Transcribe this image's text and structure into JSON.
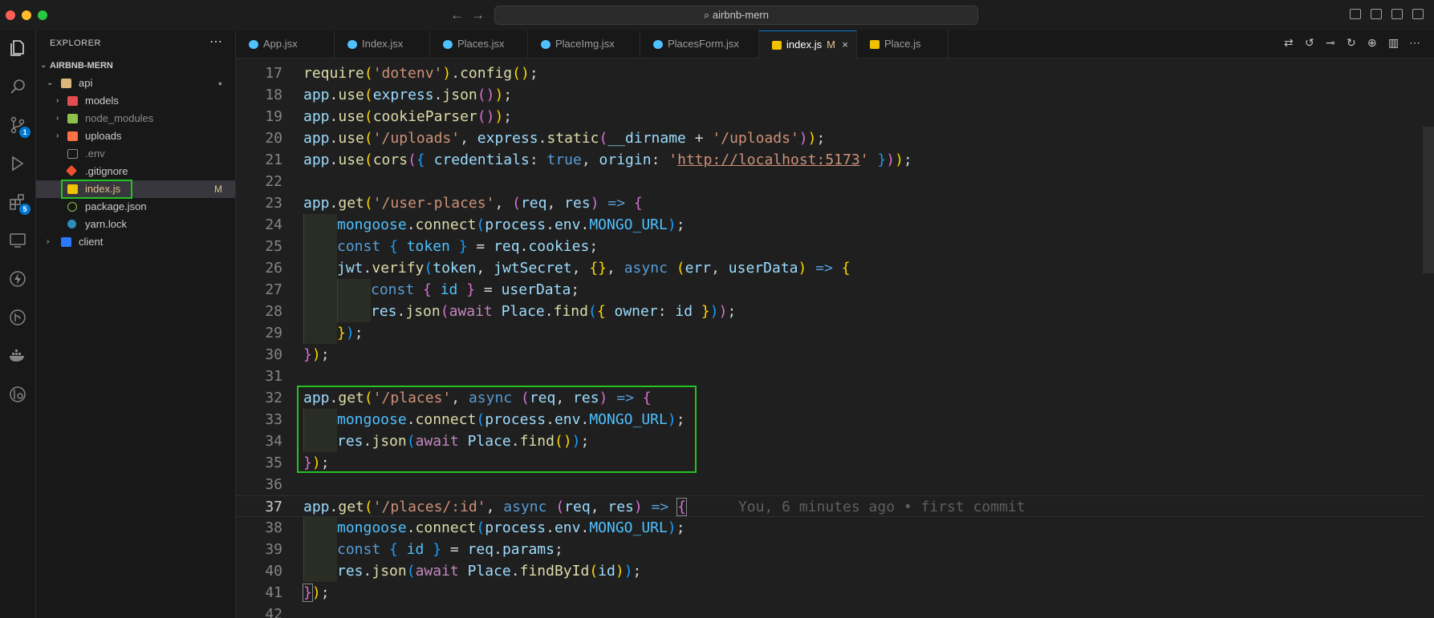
{
  "window": {
    "search_text": "airbnb-mern"
  },
  "activity_bar": {
    "source_control_badge": "1",
    "extensions_badge": "5"
  },
  "explorer": {
    "title": "EXPLORER",
    "project": "AIRBNB-MERN",
    "items": [
      {
        "label": "api",
        "mark": "●"
      },
      {
        "label": "models"
      },
      {
        "label": "node_modules"
      },
      {
        "label": "uploads"
      },
      {
        "label": ".env"
      },
      {
        "label": ".gitignore"
      },
      {
        "label": "index.js",
        "mark": "M"
      },
      {
        "label": "package.json"
      },
      {
        "label": "yarn.lock"
      },
      {
        "label": "client"
      }
    ]
  },
  "tabs": [
    {
      "label": "App.jsx"
    },
    {
      "label": "Index.jsx"
    },
    {
      "label": "Places.jsx"
    },
    {
      "label": "PlaceImg.jsx"
    },
    {
      "label": "PlacesForm.jsx"
    },
    {
      "label": "index.js",
      "modified": "M",
      "close": "×"
    },
    {
      "label": "Place.js"
    }
  ],
  "editor": {
    "line_numbers": [
      "17",
      "18",
      "19",
      "20",
      "21",
      "22",
      "23",
      "24",
      "25",
      "26",
      "27",
      "28",
      "29",
      "30",
      "31",
      "32",
      "33",
      "34",
      "35",
      "36",
      "37",
      "38",
      "39",
      "40",
      "41",
      "42"
    ],
    "blame": "You, 6 minutes ago • first commit"
  },
  "colors": {
    "accent": "#0078d4",
    "highlight_box": "#22c322",
    "modified": "#e2c08d"
  }
}
